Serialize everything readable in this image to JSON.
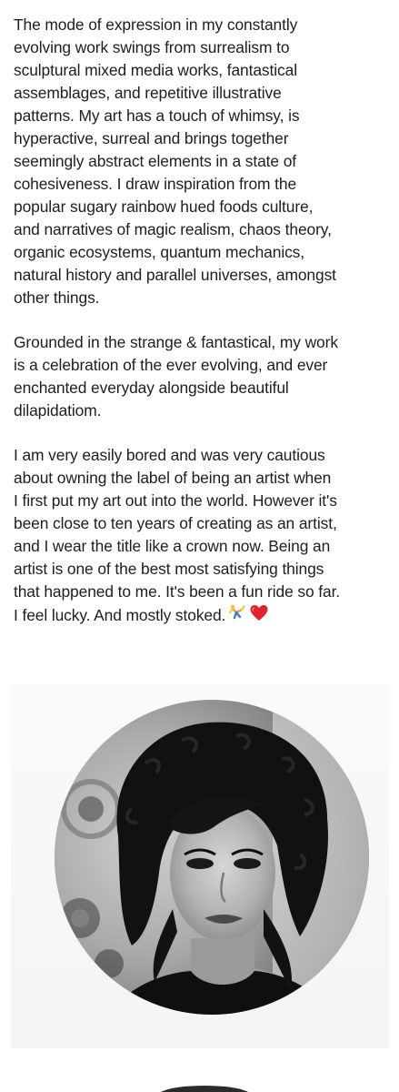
{
  "bio": {
    "paragraph_1": "The mode of expression in my constantly\nevolving work swings from surrealism to\nsculptural mixed media works, fantastical\nassemblages, and repetitive illustrative\npatterns. My art has a touch of whimsy, is\nhyperactive, surreal and brings together\nseemingly abstract elements in a state of\ncohesiveness. I draw inspiration from the\npopular sugary rainbow hued foods culture,\nand narratives of magic realism, chaos theory,\norganic ecosystems, quantum mechanics,\nnatural history and parallel universes, amongst\nother things.",
    "paragraph_2": "Grounded in the strange & fantastical, my work\nis a celebration of the ever evolving, and ever\nenchanted everyday alongside beautiful\ndilapidatiom.",
    "paragraph_3": "I am very easily bored and was very cautious\nabout owning the label of being an artist when\nI first put my art out into the world. However it's\nbeen close to ten years of creating as an artist,\nand I wear the title like a crown now. Being an\nartist is one of the best most satisfying things\nthat happened to me. It's been a fun ride so far.\nI feel lucky.  And mostly stoked.",
    "emoji_1": "cartwheel-person",
    "emoji_2": "red-heart"
  },
  "colors": {
    "text": "#1e1e1e",
    "heart": "#e0242f",
    "photo_background": "#f6f6f6"
  }
}
